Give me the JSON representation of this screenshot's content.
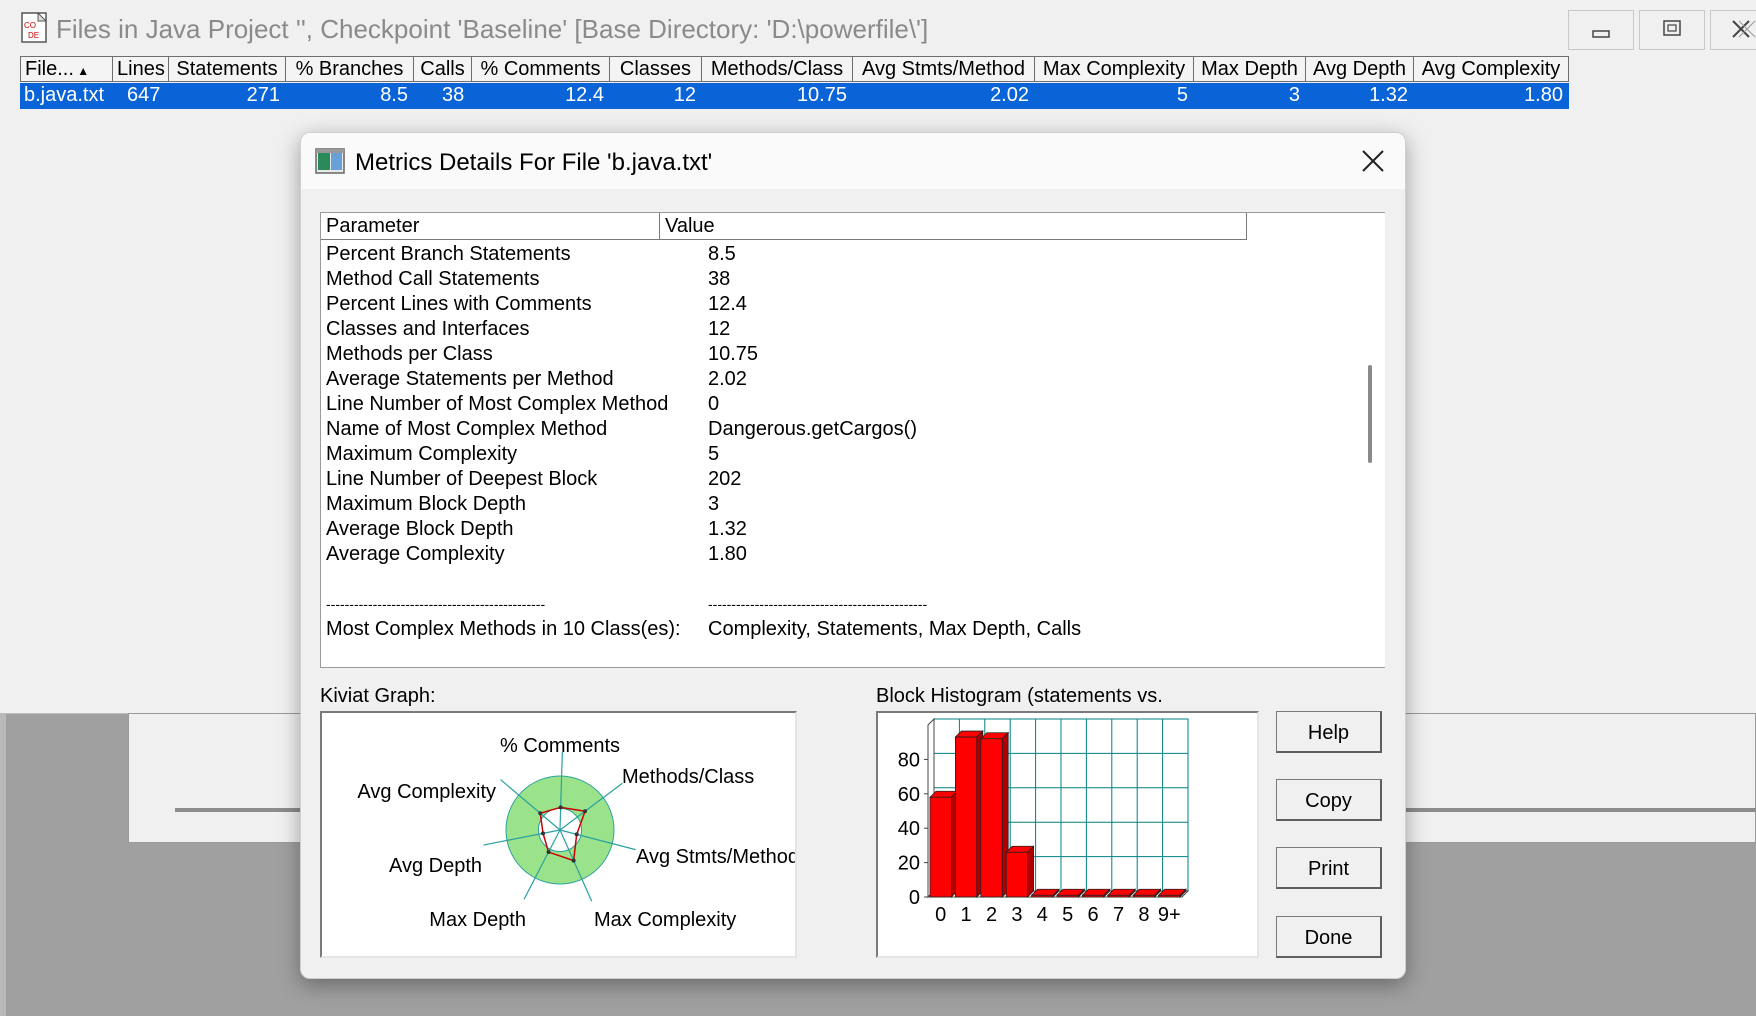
{
  "main_window": {
    "title": "Files in Java Project '', Checkpoint 'Baseline'  [Base Directory: 'D:\\powerfile\\']",
    "columns": [
      {
        "label": "File...",
        "width": 93
      },
      {
        "label": "Lines",
        "width": 56
      },
      {
        "label": "Statements",
        "width": 117
      },
      {
        "label": "% Branches",
        "width": 128
      },
      {
        "label": "Calls",
        "width": 58
      },
      {
        "label": "% Comments",
        "width": 138
      },
      {
        "label": "Classes",
        "width": 92
      },
      {
        "label": "Methods/Class",
        "width": 151
      },
      {
        "label": "Avg Stmts/Method",
        "width": 182
      },
      {
        "label": "Max Complexity",
        "width": 159
      },
      {
        "label": "Max Depth",
        "width": 112
      },
      {
        "label": "Avg Depth",
        "width": 108
      },
      {
        "label": "Avg Complexity",
        "width": 155
      }
    ],
    "rows": [
      [
        "b.java.txt",
        "647",
        "271",
        "8.5",
        "38",
        "12.4",
        "12",
        "10.75",
        "2.02",
        "5",
        "3",
        "1.32",
        "1.80"
      ]
    ]
  },
  "dialog": {
    "title": "Metrics Details For File 'b.java.txt'",
    "table_headers": {
      "parameter": "Parameter",
      "value": "Value"
    },
    "rows": [
      {
        "parameter": "Percent Branch Statements",
        "value": "8.5"
      },
      {
        "parameter": "Method Call Statements",
        "value": "38"
      },
      {
        "parameter": "Percent Lines with Comments",
        "value": "12.4"
      },
      {
        "parameter": "Classes and Interfaces",
        "value": "12"
      },
      {
        "parameter": "Methods per Class",
        "value": "10.75"
      },
      {
        "parameter": "Average Statements per Method",
        "value": "2.02"
      },
      {
        "parameter": "Line Number of Most Complex Method",
        "value": "0"
      },
      {
        "parameter": "Name of Most Complex Method",
        "value": "Dangerous.getCargos()"
      },
      {
        "parameter": "Maximum Complexity",
        "value": "5"
      },
      {
        "parameter": "Line Number of Deepest Block",
        "value": "202"
      },
      {
        "parameter": "Maximum Block Depth",
        "value": "3"
      },
      {
        "parameter": "Average Block Depth",
        "value": "1.32"
      },
      {
        "parameter": "Average Complexity",
        "value": "1.80"
      },
      {
        "parameter": "",
        "value": ""
      },
      {
        "parameter": "-----------------------------------------------",
        "value": "-----------------------------------------------"
      },
      {
        "parameter": "Most Complex Methods in 10 Class(es):",
        "value": "Complexity, Statements, Max Depth, Calls"
      }
    ],
    "kiviat_label": "Kiviat Graph:",
    "histogram_label": "Block Histogram (statements vs.",
    "buttons": {
      "help": "Help",
      "copy": "Copy",
      "print": "Print",
      "done": "Done"
    }
  },
  "chart_data": [
    {
      "type": "radar",
      "axes": [
        "% Comments",
        "Methods/Class",
        "Avg Stmts/Method",
        "Max Complexity",
        "Max Depth",
        "Avg Depth",
        "Avg Complexity"
      ],
      "values": [
        0.42,
        0.58,
        0.32,
        0.62,
        0.46,
        0.32,
        0.48
      ],
      "band": [
        0.4,
        1.0
      ],
      "band_color": "#9be38a",
      "line_color": "#cc0000"
    },
    {
      "type": "bar",
      "categories": [
        "0",
        "1",
        "2",
        "3",
        "4",
        "5",
        "6",
        "7",
        "8",
        "9+"
      ],
      "values": [
        58,
        93,
        92,
        26,
        1,
        1,
        1,
        1,
        1,
        1
      ],
      "ylim": [
        0,
        100
      ],
      "yticks": [
        "0",
        "20",
        "40",
        "60",
        "80"
      ],
      "bar_color": "#ff0000",
      "grid_color": "#008080"
    }
  ]
}
